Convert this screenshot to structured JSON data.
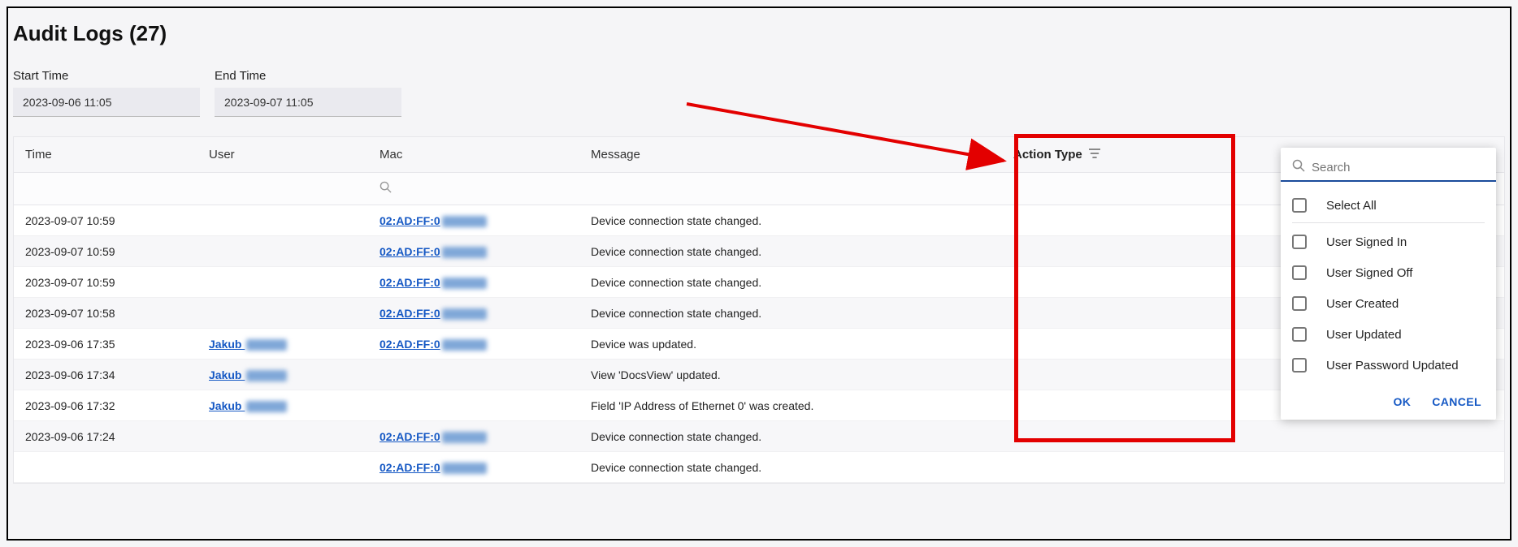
{
  "title": "Audit Logs (27)",
  "filters": {
    "start_label": "Start Time",
    "start_value": "2023-09-06 11:05",
    "end_label": "End Time",
    "end_value": "2023-09-07 11:05"
  },
  "columns": {
    "time": "Time",
    "user": "User",
    "mac": "Mac",
    "message": "Message",
    "action_type": "Action Type"
  },
  "rows": [
    {
      "time": "2023-09-07 10:59",
      "user": "",
      "mac_prefix": "02:AD:FF:0",
      "msg": "Device connection state changed."
    },
    {
      "time": "2023-09-07 10:59",
      "user": "",
      "mac_prefix": "02:AD:FF:0",
      "msg": "Device connection state changed."
    },
    {
      "time": "2023-09-07 10:59",
      "user": "",
      "mac_prefix": "02:AD:FF:0",
      "msg": "Device connection state changed."
    },
    {
      "time": "2023-09-07 10:58",
      "user": "",
      "mac_prefix": "02:AD:FF:0",
      "msg": "Device connection state changed."
    },
    {
      "time": "2023-09-06 17:35",
      "user": "Jakub",
      "mac_prefix": "02:AD:FF:0",
      "msg": "Device was updated."
    },
    {
      "time": "2023-09-06 17:34",
      "user": "Jakub",
      "mac_prefix": "",
      "msg": "View 'DocsView' updated."
    },
    {
      "time": "2023-09-06 17:32",
      "user": "Jakub",
      "mac_prefix": "",
      "msg": "Field 'IP Address of Ethernet 0' was created."
    },
    {
      "time": "2023-09-06 17:24",
      "user": "",
      "mac_prefix": "02:AD:FF:0",
      "msg": "Device connection state changed."
    },
    {
      "time": "",
      "user": "",
      "mac_prefix": "02:AD:FF:0",
      "msg": "Device connection state changed."
    }
  ],
  "filter_popup": {
    "search_placeholder": "Search",
    "select_all": "Select All",
    "options": [
      "User Signed In",
      "User Signed Off",
      "User Created",
      "User Updated",
      "User Password Updated"
    ],
    "ok": "OK",
    "cancel": "CANCEL"
  }
}
